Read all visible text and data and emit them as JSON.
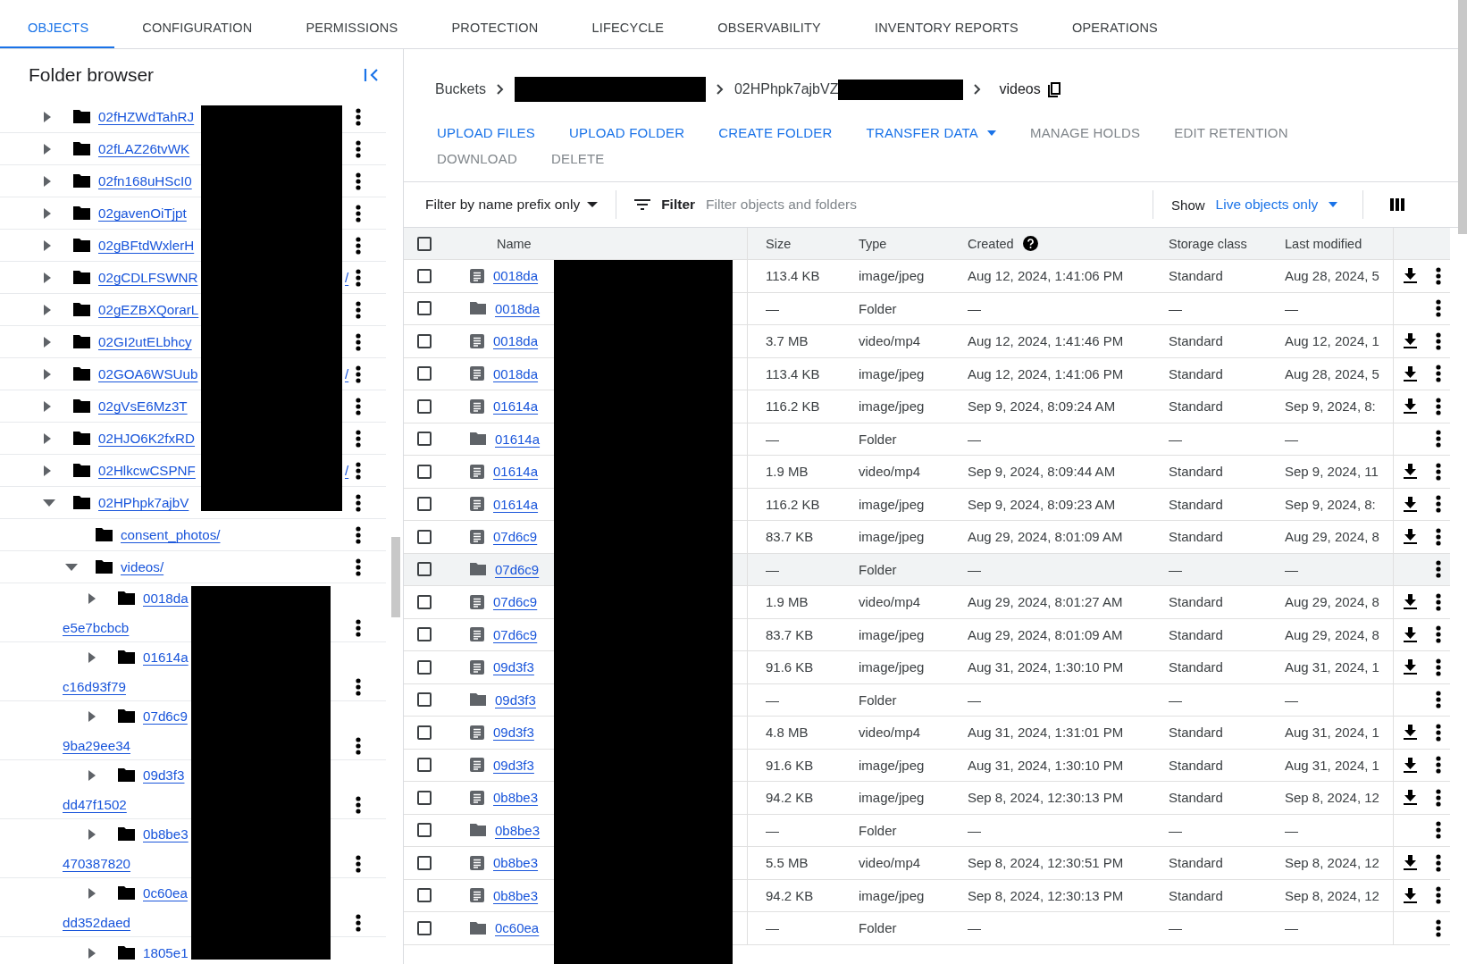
{
  "tabs": [
    {
      "label": "OBJECTS",
      "selected": true
    },
    {
      "label": "CONFIGURATION",
      "selected": false
    },
    {
      "label": "PERMISSIONS",
      "selected": false
    },
    {
      "label": "PROTECTION",
      "selected": false
    },
    {
      "label": "LIFECYCLE",
      "selected": false
    },
    {
      "label": "OBSERVABILITY",
      "selected": false
    },
    {
      "label": "INVENTORY REPORTS",
      "selected": false
    },
    {
      "label": "OPERATIONS",
      "selected": false
    }
  ],
  "folder_browser": {
    "title": "Folder browser",
    "tree": [
      {
        "name": "02fHZWdTahRJ",
        "expanded": false
      },
      {
        "name": "02fLAZ26tvWK",
        "expanded": false
      },
      {
        "name": "02fn168uHScI0",
        "expanded": false
      },
      {
        "name": "02gavenOiTjpt",
        "expanded": false
      },
      {
        "name": "02gBFtdWxlerH",
        "expanded": false
      },
      {
        "name": "02gCDLFSWNR",
        "tail": "/",
        "expanded": false
      },
      {
        "name": "02gEZBXQorarL",
        "expanded": false
      },
      {
        "name": "02GI2utELbhcy",
        "expanded": false
      },
      {
        "name": "02GOA6WSUub",
        "tail": "/",
        "expanded": false
      },
      {
        "name": "02gVsE6Mz3T",
        "expanded": false
      },
      {
        "name": "02HJO6K2fxRD",
        "expanded": false
      },
      {
        "name": "02HlkcwCSPNF",
        "tail": "/",
        "expanded": false
      },
      {
        "name": "02HPhpk7ajbV",
        "expanded": true,
        "children": [
          {
            "name": "consent_photos/"
          },
          {
            "name": "videos/",
            "expanded": true,
            "children": [
              {
                "name": "0018da",
                "name_cont": "e5e7bcbcb",
                "expanded": false
              },
              {
                "name": "01614a",
                "name_cont": "c16d93f79",
                "expanded": false
              },
              {
                "name": "07d6c9",
                "name_cont": "9ba29ee34",
                "expanded": false
              },
              {
                "name": "09d3f3",
                "name_cont": "dd47f1502",
                "expanded": false
              },
              {
                "name": "0b8be3",
                "name_cont": "470387820",
                "expanded": false
              },
              {
                "name": "0c60ea",
                "name_cont": "dd352daed",
                "expanded": false
              },
              {
                "name": "1805e1",
                "expanded": false
              }
            ]
          }
        ]
      }
    ]
  },
  "breadcrumb": {
    "root": "Buckets",
    "folder": "02HPhpk7ajbVZ",
    "current": "videos"
  },
  "actions": [
    {
      "label": "UPLOAD FILES",
      "disabled": false,
      "dropdown": false
    },
    {
      "label": "UPLOAD FOLDER",
      "disabled": false,
      "dropdown": false
    },
    {
      "label": "CREATE FOLDER",
      "disabled": false,
      "dropdown": false
    },
    {
      "label": "TRANSFER DATA",
      "disabled": false,
      "dropdown": true
    },
    {
      "label": "MANAGE HOLDS",
      "disabled": true,
      "dropdown": false
    },
    {
      "label": "EDIT RETENTION",
      "disabled": true,
      "dropdown": false
    },
    {
      "label": "DOWNLOAD",
      "disabled": true,
      "dropdown": false
    },
    {
      "label": "DELETE",
      "disabled": true,
      "dropdown": false
    }
  ],
  "filter": {
    "mode": "Filter by name prefix only",
    "label": "Filter",
    "placeholder": "Filter objects and folders",
    "show_label": "Show",
    "show_value": "Live objects only"
  },
  "table": {
    "all_checked": false,
    "columns": [
      "Name",
      "Size",
      "Type",
      "Created",
      "Storage class",
      "Last modified"
    ],
    "rows": [
      {
        "kind": "file",
        "name": "0018da",
        "size": "113.4 KB",
        "type": "image/jpeg",
        "created": "Aug 12, 2024, 1:41:06 PM",
        "storage_class": "Standard",
        "last_modified": "Aug 28, 2024, 5",
        "checked": false,
        "highlighted": false
      },
      {
        "kind": "folder",
        "name": "0018da",
        "size": "—",
        "type": "Folder",
        "created": "—",
        "storage_class": "—",
        "last_modified": "—",
        "checked": false,
        "highlighted": false
      },
      {
        "kind": "file",
        "name": "0018da",
        "size": "3.7 MB",
        "type": "video/mp4",
        "created": "Aug 12, 2024, 1:41:46 PM",
        "storage_class": "Standard",
        "last_modified": "Aug 12, 2024, 1",
        "checked": false,
        "highlighted": false
      },
      {
        "kind": "file",
        "name": "0018da",
        "size": "113.4 KB",
        "type": "image/jpeg",
        "created": "Aug 12, 2024, 1:41:06 PM",
        "storage_class": "Standard",
        "last_modified": "Aug 28, 2024, 5",
        "checked": false,
        "highlighted": false
      },
      {
        "kind": "file",
        "name": "01614a",
        "size": "116.2 KB",
        "type": "image/jpeg",
        "created": "Sep 9, 2024, 8:09:24 AM",
        "storage_class": "Standard",
        "last_modified": "Sep 9, 2024, 8:",
        "checked": false,
        "highlighted": false
      },
      {
        "kind": "folder",
        "name": "01614a",
        "size": "—",
        "type": "Folder",
        "created": "—",
        "storage_class": "—",
        "last_modified": "—",
        "checked": false,
        "highlighted": false
      },
      {
        "kind": "file",
        "name": "01614a",
        "size": "1.9 MB",
        "type": "video/mp4",
        "created": "Sep 9, 2024, 8:09:44 AM",
        "storage_class": "Standard",
        "last_modified": "Sep 9, 2024, 11",
        "checked": false,
        "highlighted": false
      },
      {
        "kind": "file",
        "name": "01614a",
        "size": "116.2 KB",
        "type": "image/jpeg",
        "created": "Sep 9, 2024, 8:09:23 AM",
        "storage_class": "Standard",
        "last_modified": "Sep 9, 2024, 8:",
        "checked": false,
        "highlighted": false
      },
      {
        "kind": "file",
        "name": "07d6c9",
        "size": "83.7 KB",
        "type": "image/jpeg",
        "created": "Aug 29, 2024, 8:01:09 AM",
        "storage_class": "Standard",
        "last_modified": "Aug 29, 2024, 8",
        "checked": false,
        "highlighted": false
      },
      {
        "kind": "folder",
        "name": "07d6c9",
        "size": "—",
        "type": "Folder",
        "created": "—",
        "storage_class": "—",
        "last_modified": "—",
        "checked": false,
        "highlighted": true
      },
      {
        "kind": "file",
        "name": "07d6c9",
        "size": "1.9 MB",
        "type": "video/mp4",
        "created": "Aug 29, 2024, 8:01:27 AM",
        "storage_class": "Standard",
        "last_modified": "Aug 29, 2024, 8",
        "checked": false,
        "highlighted": false
      },
      {
        "kind": "file",
        "name": "07d6c9",
        "size": "83.7 KB",
        "type": "image/jpeg",
        "created": "Aug 29, 2024, 8:01:09 AM",
        "storage_class": "Standard",
        "last_modified": "Aug 29, 2024, 8",
        "checked": false,
        "highlighted": false
      },
      {
        "kind": "file",
        "name": "09d3f3",
        "size": "91.6 KB",
        "type": "image/jpeg",
        "created": "Aug 31, 2024, 1:30:10 PM",
        "storage_class": "Standard",
        "last_modified": "Aug 31, 2024, 1",
        "checked": false,
        "highlighted": false
      },
      {
        "kind": "folder",
        "name": "09d3f3",
        "size": "—",
        "type": "Folder",
        "created": "—",
        "storage_class": "—",
        "last_modified": "—",
        "checked": false,
        "highlighted": false
      },
      {
        "kind": "file",
        "name": "09d3f3",
        "size": "4.8 MB",
        "type": "video/mp4",
        "created": "Aug 31, 2024, 1:31:01 PM",
        "storage_class": "Standard",
        "last_modified": "Aug 31, 2024, 1",
        "checked": false,
        "highlighted": false
      },
      {
        "kind": "file",
        "name": "09d3f3",
        "size": "91.6 KB",
        "type": "image/jpeg",
        "created": "Aug 31, 2024, 1:30:10 PM",
        "storage_class": "Standard",
        "last_modified": "Aug 31, 2024, 1",
        "checked": false,
        "highlighted": false
      },
      {
        "kind": "file",
        "name": "0b8be3",
        "size": "94.2 KB",
        "type": "image/jpeg",
        "created": "Sep 8, 2024, 12:30:13 PM",
        "storage_class": "Standard",
        "last_modified": "Sep 8, 2024, 12",
        "checked": false,
        "highlighted": false
      },
      {
        "kind": "folder",
        "name": "0b8be3",
        "size": "—",
        "type": "Folder",
        "created": "—",
        "storage_class": "—",
        "last_modified": "—",
        "checked": false,
        "highlighted": false
      },
      {
        "kind": "file",
        "name": "0b8be3",
        "size": "5.5 MB",
        "type": "video/mp4",
        "created": "Sep 8, 2024, 12:30:51 PM",
        "storage_class": "Standard",
        "last_modified": "Sep 8, 2024, 12",
        "checked": false,
        "highlighted": false
      },
      {
        "kind": "file",
        "name": "0b8be3",
        "size": "94.2 KB",
        "type": "image/jpeg",
        "created": "Sep 8, 2024, 12:30:13 PM",
        "storage_class": "Standard",
        "last_modified": "Sep 8, 2024, 12",
        "checked": false,
        "highlighted": false
      },
      {
        "kind": "folder",
        "name": "0c60ea",
        "size": "—",
        "type": "Folder",
        "created": "—",
        "storage_class": "—",
        "last_modified": "—",
        "checked": false,
        "highlighted": false
      }
    ]
  }
}
